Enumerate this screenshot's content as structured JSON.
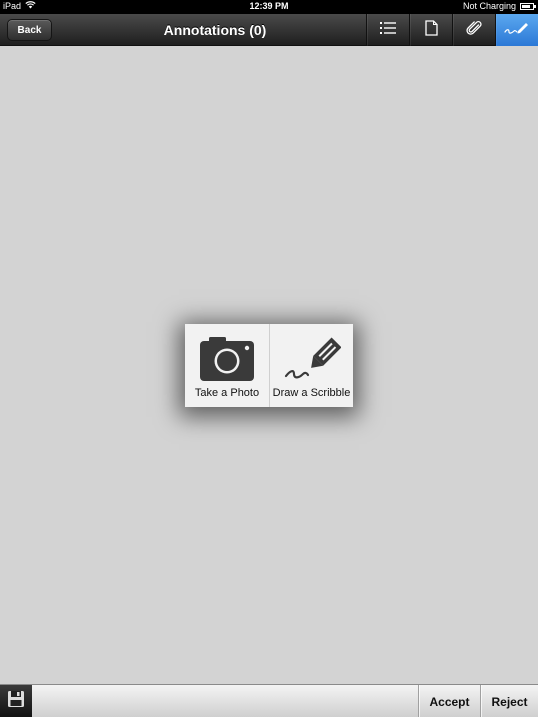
{
  "status_bar": {
    "device": "iPad",
    "time": "12:39 PM",
    "charging": "Not Charging",
    "battery_level": 0.8
  },
  "nav": {
    "back_label": "Back",
    "title": "Annotations (0)",
    "tools": [
      {
        "icon": "list-icon",
        "active": false
      },
      {
        "icon": "document-icon",
        "active": false
      },
      {
        "icon": "paperclip-icon",
        "active": false
      },
      {
        "icon": "scribble-pen-icon",
        "active": true
      }
    ]
  },
  "popover": {
    "items": [
      {
        "label": "Take a Photo",
        "icon": "camera-icon"
      },
      {
        "label": "Draw a Scribble",
        "icon": "pen-scribble-icon"
      }
    ]
  },
  "bottom_bar": {
    "save_icon": "floppy-disk-icon",
    "accept_label": "Accept",
    "reject_label": "Reject"
  },
  "colors": {
    "background": "#d3d3d3",
    "active_tool": "#3d8ee3",
    "nav_bar": "#2e2e2e"
  }
}
